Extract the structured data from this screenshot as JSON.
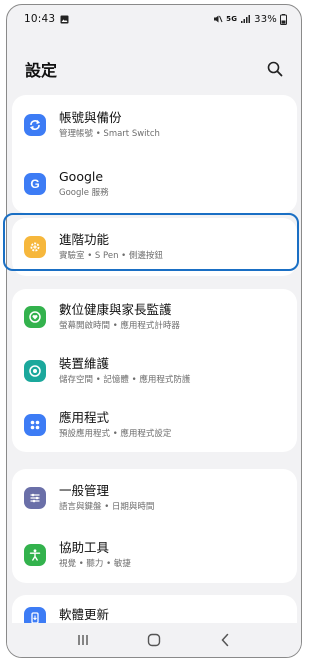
{
  "status": {
    "time": "10:43",
    "battery": "33%",
    "net": "5G"
  },
  "header": {
    "title": "設定"
  },
  "groups": [
    {
      "items": [
        {
          "label": "帳號與備份",
          "sub": "管理帳號 • Smart Switch",
          "icon": "sync-icon",
          "color": "#3d7cf5"
        },
        {
          "label": "Google",
          "sub": "Google 服務",
          "icon": "google-icon",
          "color": "#3d7cf5"
        }
      ]
    },
    {
      "items": [
        {
          "label": "進階功能",
          "sub": "實驗室 • S Pen • 側邊按鈕",
          "icon": "gear-plus-icon",
          "color": "#f6b73c"
        }
      ]
    },
    {
      "items": [
        {
          "label": "數位健康與家長監護",
          "sub": "螢幕開啟時間 • 應用程式計時器",
          "icon": "heart-circle-icon",
          "color": "#33b24d"
        },
        {
          "label": "裝置維護",
          "sub": "儲存空間 • 記憶體 • 應用程式防護",
          "icon": "care-icon",
          "color": "#1ba89c"
        },
        {
          "label": "應用程式",
          "sub": "預設應用程式 • 應用程式設定",
          "icon": "apps-grid-icon",
          "color": "#3d7cf5"
        }
      ]
    },
    {
      "items": [
        {
          "label": "一般管理",
          "sub": "語言與鍵盤 • 日期與時間",
          "icon": "sliders-icon",
          "color": "#6a6fa8"
        },
        {
          "label": "協助工具",
          "sub": "視覺 • 聽力 • 敏捷",
          "icon": "accessibility-icon",
          "color": "#33b24d"
        }
      ]
    },
    {
      "items": [
        {
          "label": "軟體更新",
          "sub": "",
          "icon": "update-icon",
          "color": "#3d7cf5"
        }
      ]
    }
  ]
}
